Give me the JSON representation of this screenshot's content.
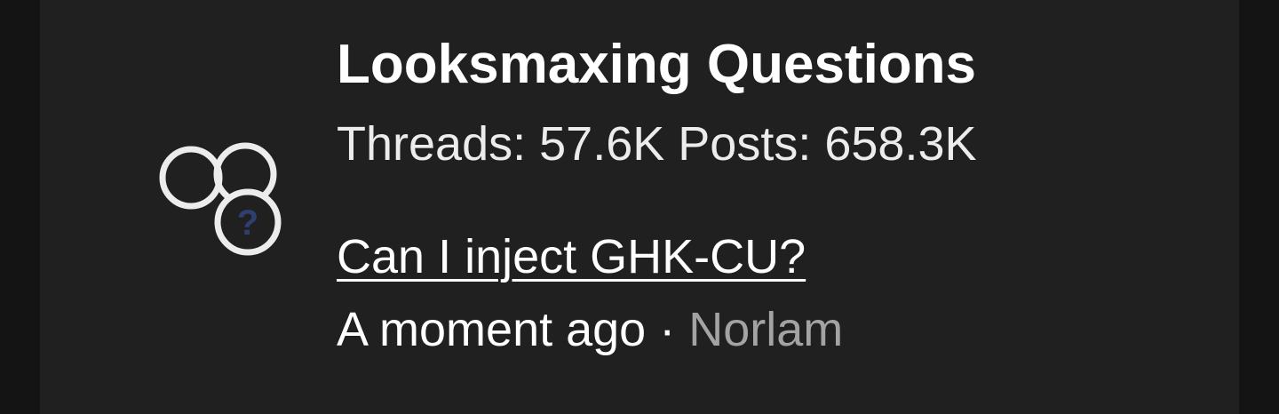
{
  "forum": {
    "title": "Looksmaxing Questions",
    "threads_label": "Threads:",
    "threads_count": "57.6K",
    "posts_label": "Posts:",
    "posts_count": "658.3K",
    "icon": "forum-question-icon"
  },
  "latest": {
    "thread_title": "Can I inject GHK-CU?",
    "time": "A moment ago",
    "separator": "·",
    "author": "Norlam"
  },
  "colors": {
    "background": "#141414",
    "card": "#202020",
    "text": "#ffffff",
    "muted": "#a3a3a3",
    "icon_stroke": "#ececec",
    "icon_question": "#2f3f72"
  }
}
